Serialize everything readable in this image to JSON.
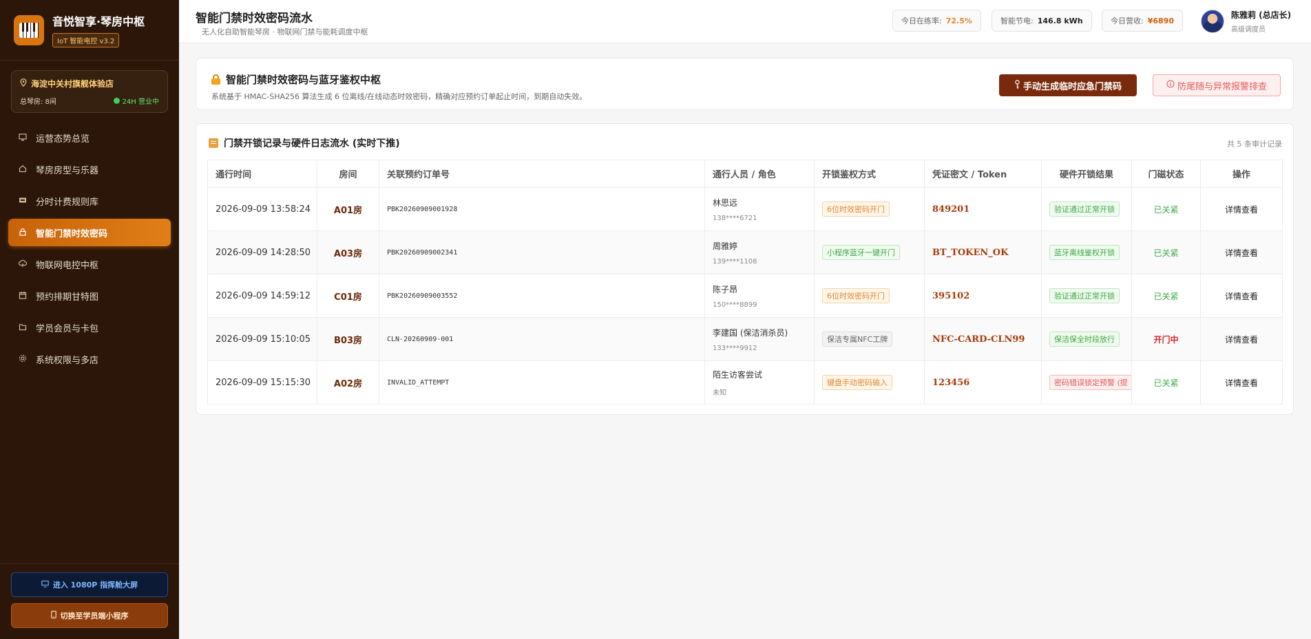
{
  "sidebar": {
    "brand_title": "音悦智享·琴房中枢",
    "brand_badge": "IoT 智能电控 v3.2",
    "store_name": "海淀中关村旗舰体验店",
    "store_rooms": "总琴房: 8间",
    "store_status": "24H 营业中",
    "nav": [
      {
        "label": "运营态势总览",
        "icon": "dashboard-icon"
      },
      {
        "label": "琴房房型与乐器",
        "icon": "home-icon"
      },
      {
        "label": "分时计费规则库",
        "icon": "billing-icon"
      },
      {
        "label": "智能门禁时效密码",
        "icon": "lock-icon",
        "active": true
      },
      {
        "label": "物联网电控中枢",
        "icon": "iot-icon"
      },
      {
        "label": "预约排期甘特图",
        "icon": "calendar-icon"
      },
      {
        "label": "学员会员与卡包",
        "icon": "folder-icon"
      },
      {
        "label": "系统权限与多店",
        "icon": "settings-icon"
      }
    ],
    "btn_screen": "进入 1080P 指挥舱大屏",
    "btn_mini": "切换至学员端小程序"
  },
  "header": {
    "title": "智能门禁时效密码流水",
    "subtitle": "无人化自助智能琴房 · 物联网门禁与能耗调度中枢",
    "stat1_label": "今日在练率:",
    "stat1_value": "72.5%",
    "stat2_label": "智能节电:",
    "stat2_value": "146.8 kWh",
    "stat3_label": "今日营收:",
    "stat3_value": "¥6890",
    "user_name": "陈雅莉 (总店长)",
    "user_role": "高级调度员"
  },
  "auth_panel": {
    "title": "智能门禁时效密码与蓝牙鉴权中枢",
    "desc": "系统基于 HMAC-SHA256 算法生成 6 位离线/在线动态时效密码，精确对应预约订单起止时间，到期自动失效。",
    "btn_generate": "手动生成临时应急门禁码",
    "btn_alert": "防尾随与异常报警排查"
  },
  "log_panel": {
    "title": "门禁开锁记录与硬件日志流水 (实时下推)",
    "count": "共 5 条审计记录",
    "columns": [
      "通行时间",
      "房间",
      "关联预约订单号",
      "通行人员 / 角色",
      "开锁鉴权方式",
      "凭证密文 / Token",
      "硬件开锁结果",
      "门磁状态",
      "操作"
    ],
    "rows": [
      {
        "time": "2026-09-09 13:58:24",
        "room": "A01房",
        "order": "PBK20260909001928",
        "person": "林思远",
        "phone": "138****6721",
        "method": "6位时效密码开门",
        "method_tone": "orange",
        "token": "849201",
        "result": "验证通过正常开锁",
        "result_tone": "green",
        "door": "已关紧",
        "door_open": false,
        "action": "详情查看"
      },
      {
        "time": "2026-09-09 14:28:50",
        "room": "A03房",
        "order": "PBK20260909002341",
        "person": "周雅婷",
        "phone": "139****1108",
        "method": "小程序蓝牙一键开门",
        "method_tone": "green",
        "token": "BT_TOKEN_OK",
        "result": "蓝牙离线鉴权开锁",
        "result_tone": "green",
        "door": "已关紧",
        "door_open": false,
        "action": "详情查看"
      },
      {
        "time": "2026-09-09 14:59:12",
        "room": "C01房",
        "order": "PBK20260909003552",
        "person": "陈子昂",
        "phone": "150****8899",
        "method": "6位时效密码开门",
        "method_tone": "orange",
        "token": "395102",
        "result": "验证通过正常开锁",
        "result_tone": "green",
        "door": "已关紧",
        "door_open": false,
        "action": "详情查看"
      },
      {
        "time": "2026-09-09 15:10:05",
        "room": "B03房",
        "order": "CLN-20260909-001",
        "person": "李建国 (保洁消杀员)",
        "phone": "133****9912",
        "method": "保洁专属NFC工牌",
        "method_tone": "gray",
        "token": "NFC-CARD-CLN99",
        "result": "保洁保全时段放行",
        "result_tone": "green",
        "door": "开门中",
        "door_open": true,
        "action": "详情查看"
      },
      {
        "time": "2026-09-09 15:15:30",
        "room": "A02房",
        "order": "INVALID_ATTEMPT",
        "person": "陌生访客尝试",
        "phone": "未知",
        "method": "键盘手动密码输入",
        "method_tone": "orange",
        "token": "123456",
        "result": "密码错误锁定预警 (提",
        "result_tone": "red",
        "door": "已关紧",
        "door_open": false,
        "action": "详情查看"
      }
    ]
  },
  "colors": {
    "sidebar_bg": "#2b1609",
    "accent": "#e07f17",
    "primary_button": "#7a2a0c",
    "danger": "#d12a2a",
    "success": "#3fa846"
  }
}
